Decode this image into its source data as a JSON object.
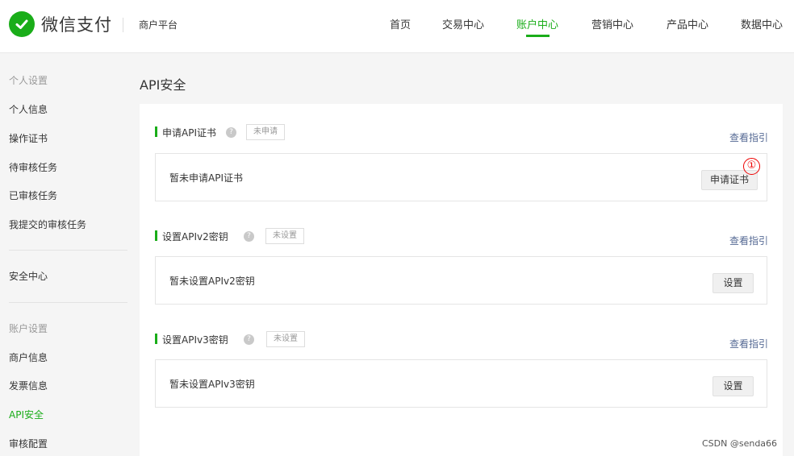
{
  "header": {
    "brand": "微信支付",
    "platform": "商户平台",
    "nav": [
      {
        "label": "首页"
      },
      {
        "label": "交易中心"
      },
      {
        "label": "账户中心",
        "active": true
      },
      {
        "label": "营销中心"
      },
      {
        "label": "产品中心"
      },
      {
        "label": "数据中心"
      }
    ]
  },
  "sidebar": {
    "group_personal": "个人设置",
    "personal_items": [
      "个人信息",
      "操作证书",
      "待审核任务",
      "已审核任务",
      "我提交的审核任务"
    ],
    "security_center": "安全中心",
    "group_account": "账户设置",
    "account_items": [
      "商户信息",
      "发票信息",
      "API安全",
      "审核配置"
    ],
    "active_item": "API安全"
  },
  "main": {
    "title": "API安全",
    "sections": [
      {
        "title": "申请API证书",
        "status": "未申请",
        "guide": "查看指引",
        "message": "暂未申请API证书",
        "button": "申请证书"
      },
      {
        "title": "设置APIv2密钥",
        "status": "未设置",
        "guide": "查看指引",
        "message": "暂未设置APIv2密钥",
        "button": "设置"
      },
      {
        "title": "设置APIv3密钥",
        "status": "未设置",
        "guide": "查看指引",
        "message": "暂未设置APIv3密钥",
        "button": "设置"
      }
    ],
    "annotation": "①",
    "help_glyph": "?"
  },
  "watermark": "CSDN @senda66",
  "colors": {
    "brand_green": "#1aad19",
    "link_blue": "#576b95",
    "annotation_red": "#e00"
  },
  "icons": {
    "logo": "wechat-pay-logo-icon",
    "help": "help-circle-icon"
  }
}
